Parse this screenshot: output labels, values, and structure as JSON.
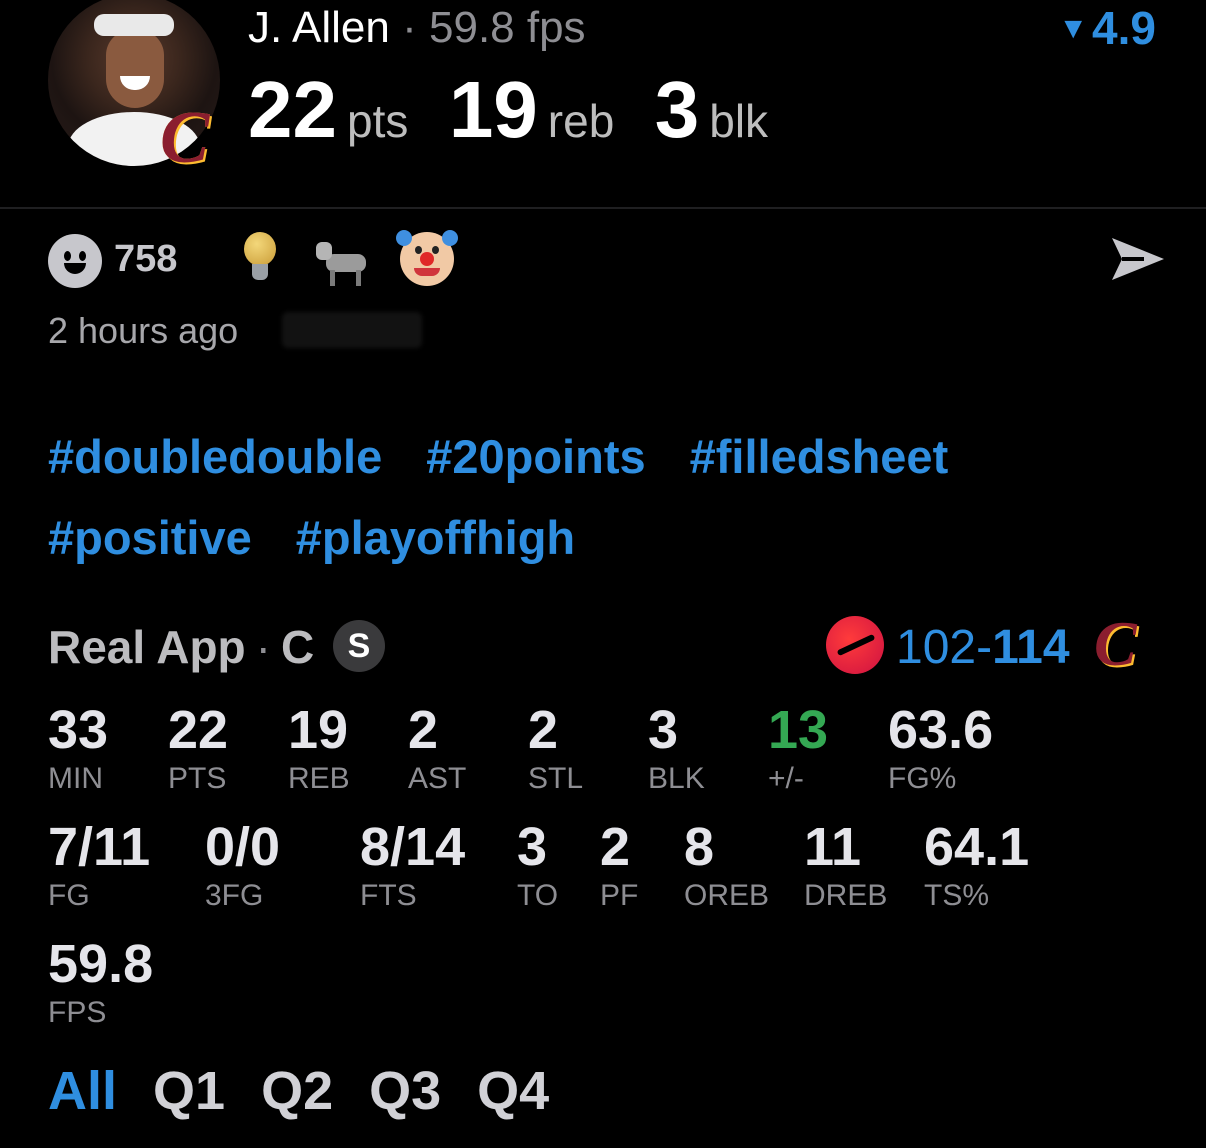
{
  "header": {
    "player_name": "J. Allen",
    "separator": "·",
    "fps_text": "59.8 fps",
    "rating": "4.9",
    "stats": [
      {
        "value": "22",
        "unit": "pts"
      },
      {
        "value": "19",
        "unit": "reb"
      },
      {
        "value": "3",
        "unit": "blk"
      }
    ]
  },
  "reactions": {
    "count": "758",
    "emojis": [
      "lightbulb-icon",
      "goat-icon",
      "clown-icon"
    ]
  },
  "post": {
    "time_ago": "2 hours ago"
  },
  "hashtags": [
    "#doubledouble",
    "#20points",
    "#filledsheet",
    "#positive",
    "#playoffhigh"
  ],
  "source": {
    "app": "Real App",
    "separator": "·",
    "position": "C",
    "badge": "S"
  },
  "game": {
    "score_loss": "102",
    "score_sep": "-",
    "score_win": "114"
  },
  "box_score": [
    {
      "value": "33",
      "label": "MIN"
    },
    {
      "value": "22",
      "label": "PTS"
    },
    {
      "value": "19",
      "label": "REB"
    },
    {
      "value": "2",
      "label": "AST"
    },
    {
      "value": "2",
      "label": "STL"
    },
    {
      "value": "3",
      "label": "BLK"
    },
    {
      "value": "13",
      "label": "+/-"
    },
    {
      "value": "63.6",
      "label": "FG%"
    },
    {
      "value": "7/11",
      "label": "FG"
    },
    {
      "value": "0/0",
      "label": "3FG"
    },
    {
      "value": "8/14",
      "label": "FTS"
    },
    {
      "value": "3",
      "label": "TO"
    },
    {
      "value": "2",
      "label": "PF"
    },
    {
      "value": "8",
      "label": "OREB"
    },
    {
      "value": "11",
      "label": "DREB"
    },
    {
      "value": "64.1",
      "label": "TS%"
    },
    {
      "value": "59.8",
      "label": "FPS"
    }
  ],
  "tabs": [
    "All",
    "Q1",
    "Q2",
    "Q3",
    "Q4"
  ],
  "colors": {
    "accent": "#2f8ee0",
    "positive": "#34a853",
    "background": "#000000"
  }
}
